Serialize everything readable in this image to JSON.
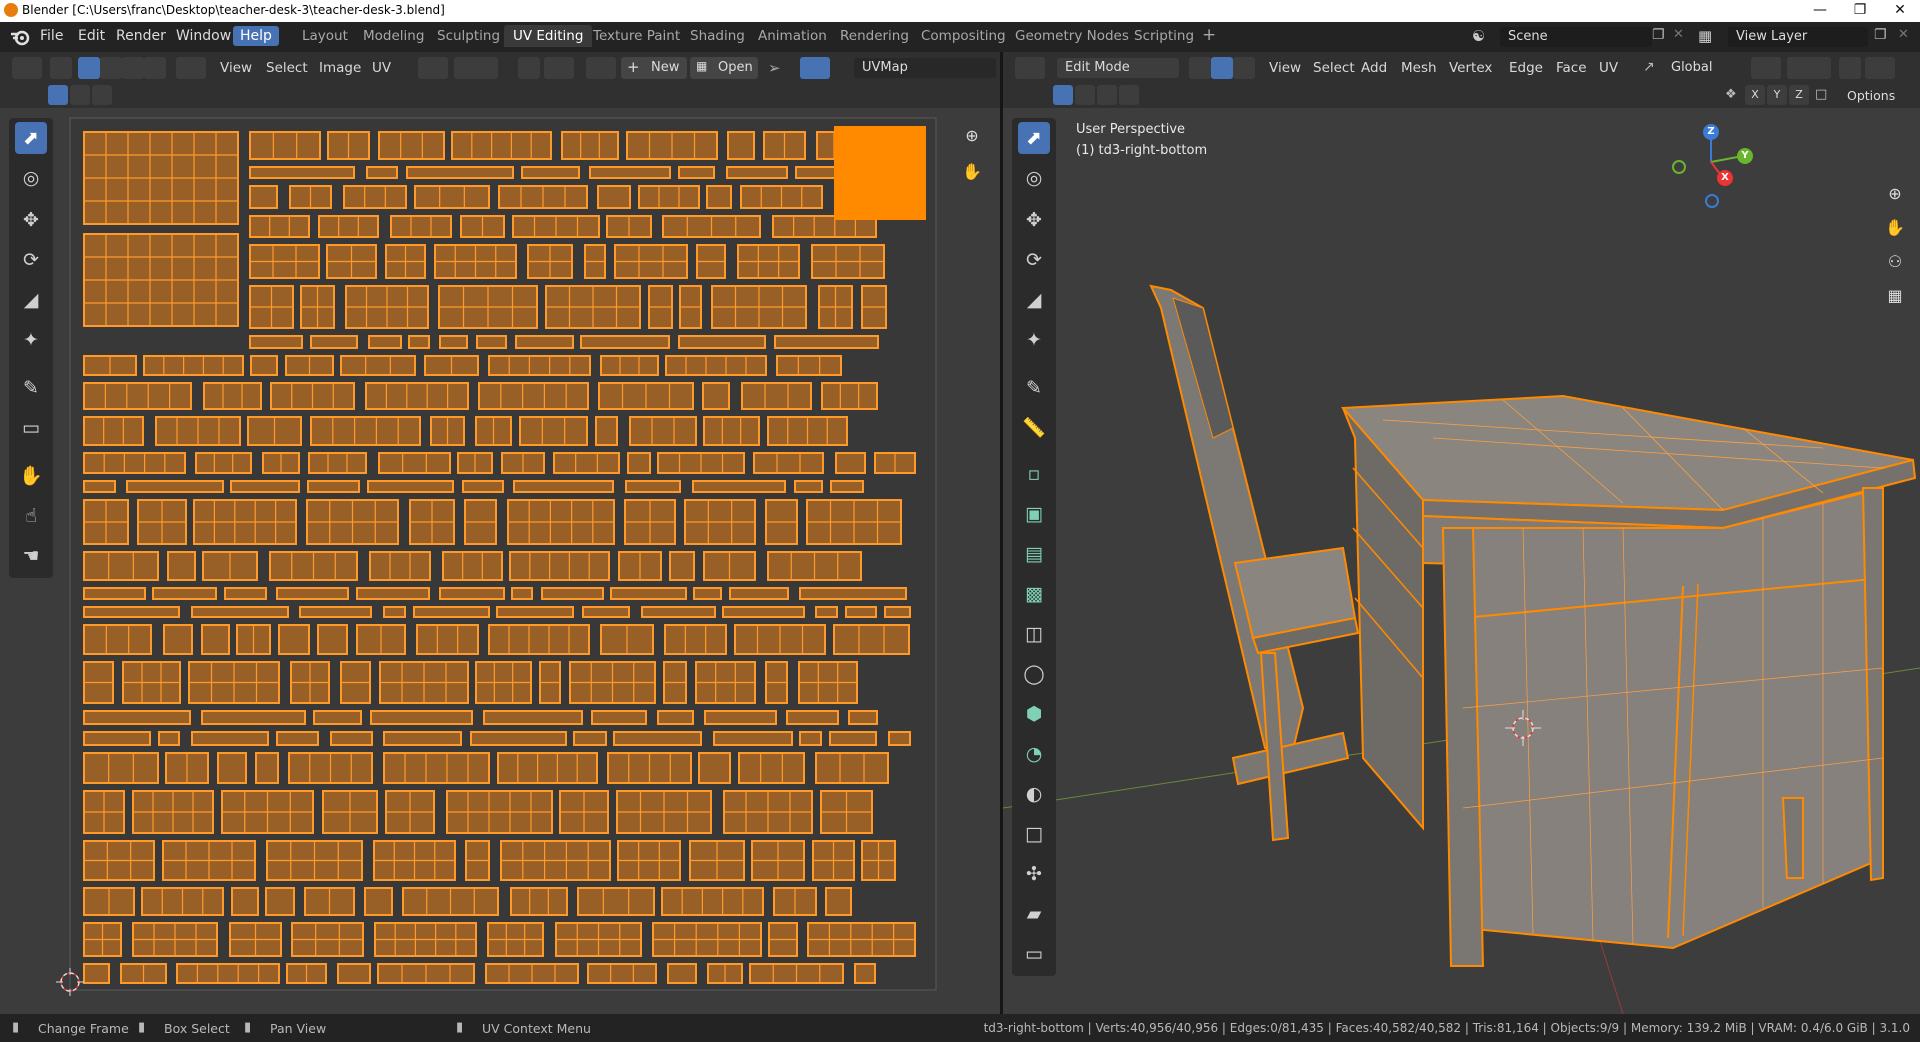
{
  "window": {
    "title": "Blender [C:\\Users\\franc\\Desktop\\teacher-desk-3\\teacher-desk-3.blend]",
    "controls": [
      "—",
      "❐",
      "✕"
    ]
  },
  "menu": [
    "File",
    "Edit",
    "Render",
    "Window",
    "Help"
  ],
  "workspaces": [
    "Layout",
    "Modeling",
    "Sculpting",
    "UV Editing",
    "Texture Paint",
    "Shading",
    "Animation",
    "Rendering",
    "Compositing",
    "Geometry Nodes",
    "Scripting"
  ],
  "active_workspace": "UV Editing",
  "add_workspace": "+",
  "scene": {
    "label": "Scene",
    "view_layer": "View Layer"
  },
  "uv_editor": {
    "menus": [
      "View",
      "Select",
      "Image",
      "UV"
    ],
    "new_label": "New",
    "open_label": "Open",
    "uvmap": "UVMap"
  },
  "viewport": {
    "mode": "Edit Mode",
    "menus": [
      "View",
      "Select",
      "Add",
      "Mesh",
      "Vertex",
      "Edge",
      "Face",
      "UV"
    ],
    "orientation": "Global",
    "axes": [
      "X",
      "Y",
      "Z"
    ],
    "options": "Options",
    "overlay_line1": "User Perspective",
    "overlay_line2": "(1) td3-right-bottom",
    "gizmo_axes": {
      "x": "X",
      "y": "Y",
      "z": "Z"
    }
  },
  "status": {
    "change_frame": "Change Frame",
    "box_select": "Box Select",
    "pan_view": "Pan View",
    "uv_context": "UV Context Menu",
    "stats": "td3-right-bottom | Verts:40,956/40,956 | Edges:0/81,435 | Faces:40,582/40,582 | Tris:81,164 | Objects:9/9 | Memory: 139.2 MiB | VRAM: 0.4/6.0 GiB | 3.1.0"
  },
  "colors": {
    "accent": "#4772b3",
    "uv_island": "#e8821a",
    "uv_island_border": "#ff9a2a",
    "selection_orange": "#ff8a00",
    "desk_gray": "#8a8580"
  }
}
